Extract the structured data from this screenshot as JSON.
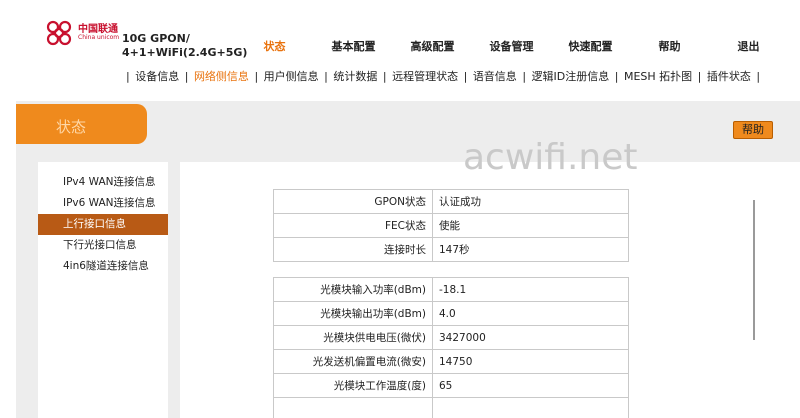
{
  "brand": {
    "cn_name": "中国联通",
    "en_name": "China unicom",
    "model_line1": "10G GPON/",
    "model_line2": "4+1+WiFi(2.4G+5G)",
    "accent_color": "#e9730e"
  },
  "mainnav": [
    {
      "label": "状态",
      "active": true
    },
    {
      "label": "基本配置",
      "active": false
    },
    {
      "label": "高级配置",
      "active": false
    },
    {
      "label": "设备管理",
      "active": false
    },
    {
      "label": "快速配置",
      "active": false
    },
    {
      "label": "帮助",
      "active": false
    },
    {
      "label": "退出",
      "active": false
    }
  ],
  "subnav": [
    {
      "label": "设备信息",
      "active": false
    },
    {
      "label": "网络侧信息",
      "active": true
    },
    {
      "label": "用户侧信息",
      "active": false
    },
    {
      "label": "统计数据",
      "active": false
    },
    {
      "label": "远程管理状态",
      "active": false
    },
    {
      "label": "语音信息",
      "active": false
    },
    {
      "label": "逻辑ID注册信息",
      "active": false
    },
    {
      "label": "MESH 拓扑图",
      "active": false
    },
    {
      "label": "插件状态",
      "active": false
    }
  ],
  "section": {
    "title": "状态",
    "help_label": "帮助"
  },
  "watermark": "acwifi.net",
  "sidebar": [
    {
      "label": "IPv4 WAN连接信息",
      "active": false
    },
    {
      "label": "IPv6 WAN连接信息",
      "active": false
    },
    {
      "label": "上行接口信息",
      "active": true
    },
    {
      "label": "下行光接口信息",
      "active": false
    },
    {
      "label": "4in6隧道连接信息",
      "active": false
    }
  ],
  "gpon_table": [
    {
      "label": "GPON状态",
      "value": "认证成功"
    },
    {
      "label": "FEC状态",
      "value": "使能"
    },
    {
      "label": "连接时长",
      "value": "147秒"
    }
  ],
  "optical_table": [
    {
      "label": "光模块输入功率(dBm)",
      "value": "-18.1"
    },
    {
      "label": "光模块输出功率(dBm)",
      "value": "4.0"
    },
    {
      "label": "光模块供电电压(微伏)",
      "value": "3427000"
    },
    {
      "label": "光发送机偏置电流(微安)",
      "value": "14750"
    },
    {
      "label": "光模块工作温度(度)",
      "value": "65"
    },
    {
      "label": "",
      "value": ""
    }
  ]
}
